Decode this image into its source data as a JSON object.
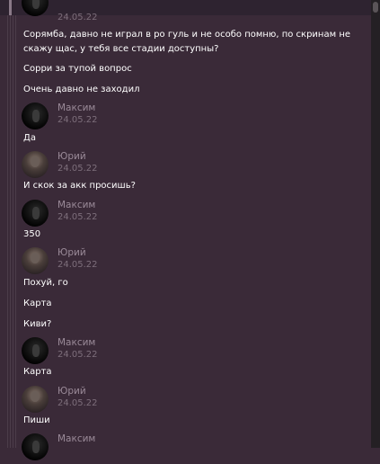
{
  "messages": [
    {
      "author": "",
      "date": "24.05.22",
      "avatar": "maxim",
      "lines": [
        "Сорямба, давно не играл в ро гуль и не особо помню, по скринам не скажу щас, у тебя все стадии доступны?",
        "Сорри за тупой вопрос",
        "Очень давно не заходил"
      ]
    },
    {
      "author": "Максим",
      "date": "24.05.22",
      "avatar": "maxim",
      "lines": [
        "Да"
      ]
    },
    {
      "author": "Юрий",
      "date": "24.05.22",
      "avatar": "yuri",
      "lines": [
        "И скок за акк просишь?"
      ]
    },
    {
      "author": "Максим",
      "date": "24.05.22",
      "avatar": "maxim",
      "lines": [
        "350"
      ]
    },
    {
      "author": "Юрий",
      "date": "24.05.22",
      "avatar": "yuri",
      "lines": [
        "Похуй, го",
        "Карта",
        "Киви?"
      ]
    },
    {
      "author": "Максим",
      "date": "24.05.22",
      "avatar": "maxim",
      "lines": [
        "Карта"
      ]
    },
    {
      "author": "Юрий",
      "date": "24.05.22",
      "avatar": "yuri",
      "lines": [
        "Пиши"
      ]
    },
    {
      "author": "Максим",
      "date": "",
      "avatar": "maxim",
      "lines": []
    }
  ]
}
